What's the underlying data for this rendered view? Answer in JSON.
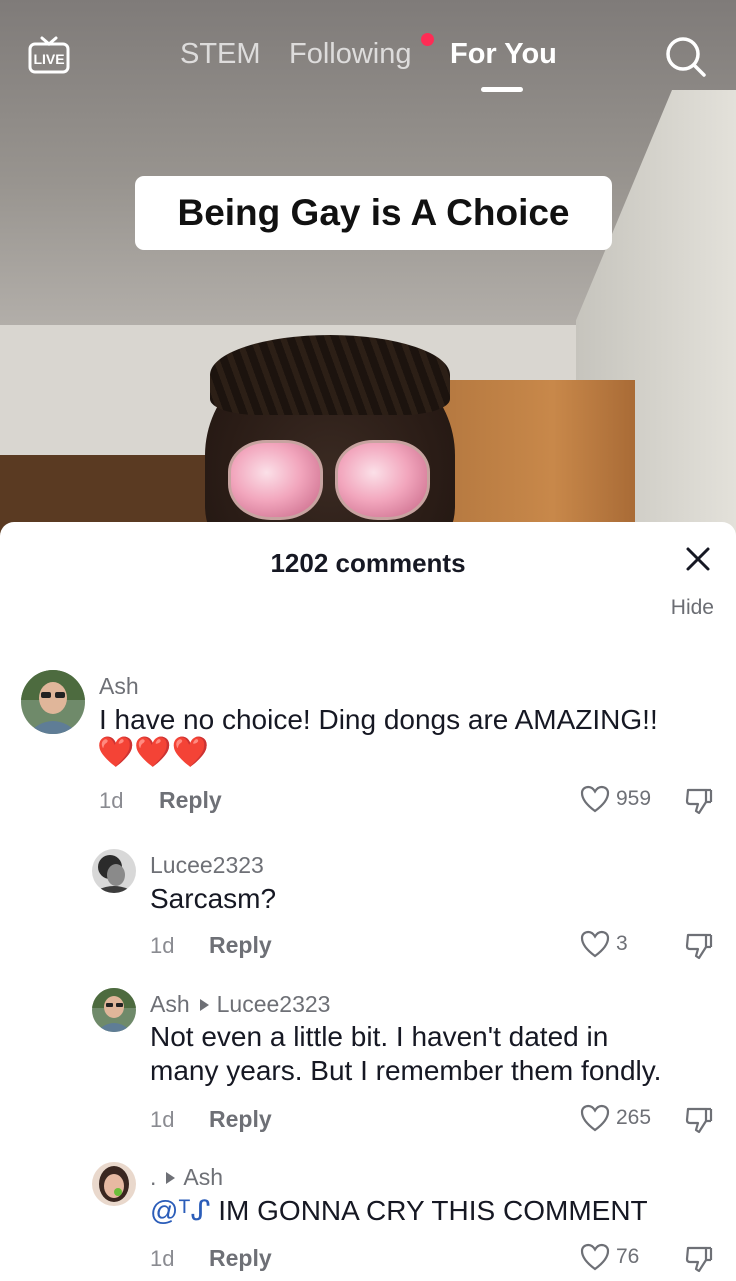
{
  "nav": {
    "live_label": "LIVE",
    "tabs": [
      {
        "label": "STEM"
      },
      {
        "label": "Following"
      },
      {
        "label": "For You"
      }
    ]
  },
  "video": {
    "caption": "Being Gay is A Choice"
  },
  "comments_panel": {
    "count_label": "1202 comments",
    "hide_label": "Hide",
    "comments": [
      {
        "username": "Ash",
        "text": "I have no choice! Ding dongs are AMAZING!!",
        "emoji": "❤️❤️❤️",
        "age": "1d",
        "reply_label": "Reply",
        "likes": "959"
      },
      {
        "username": "Lucee2323",
        "text": "Sarcasm?",
        "age": "1d",
        "reply_label": "Reply",
        "likes": "3"
      },
      {
        "username": "Ash",
        "reply_to": "Lucee2323",
        "text_line1": "Not even a little bit. I haven't dated in",
        "text_line2": "many years. But I remember them fondly.",
        "age": "1d",
        "reply_label": "Reply",
        "likes": "265"
      },
      {
        "username": ".",
        "reply_to": "Ash",
        "mention": "@ᵀᔑ",
        "text": " IM GONNA CRY THIS COMMENT",
        "age": "1d",
        "reply_label": "Reply",
        "likes": "76"
      }
    ]
  },
  "colors": {
    "accent_dot": "#fe2c55",
    "mention": "#2b5db9",
    "heart": "#e8242f"
  }
}
